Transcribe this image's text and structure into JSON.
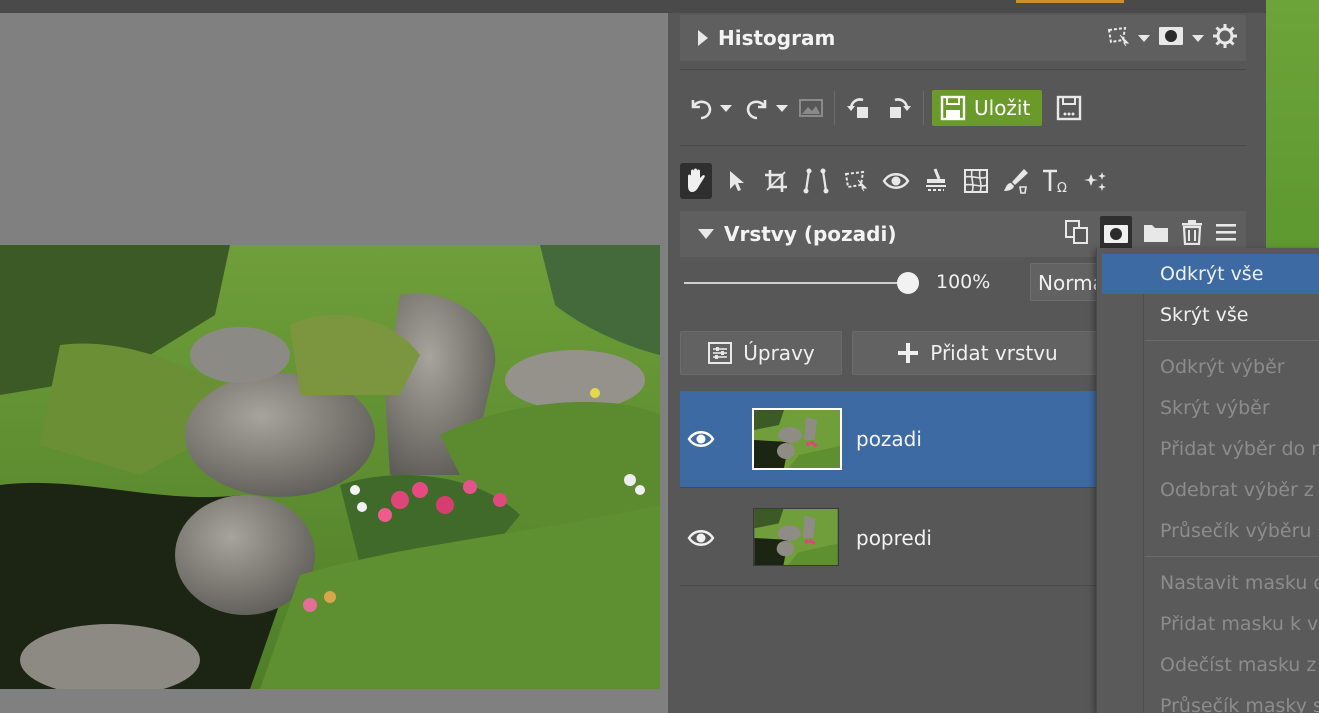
{
  "panel": {
    "histogram": {
      "title": "Histogram"
    },
    "toolbar": {
      "save_label": "Uložit"
    },
    "layers": {
      "title": "Vrstvy (pozadi)",
      "opacity": "100%",
      "blend_mode": "Normální",
      "edits_button": "Úpravy",
      "add_layer_button": "Přidat vrstvu",
      "items": [
        {
          "name": "pozadi",
          "selected": true
        },
        {
          "name": "popredi",
          "selected": false
        }
      ]
    }
  },
  "mask_menu": {
    "items": [
      {
        "label": "Odkrýt vše",
        "enabled": true,
        "highlighted": true
      },
      {
        "label": "Skrýt vše",
        "enabled": true
      },
      {
        "label": "Odkrýt výběr",
        "enabled": false
      },
      {
        "label": "Skrýt výběr",
        "enabled": false
      },
      {
        "label": "Přidat výběr do masky",
        "enabled": false
      },
      {
        "label": "Odebrat výběr z masky",
        "enabled": false
      },
      {
        "label": "Průsečík výběru s maskou",
        "enabled": false
      },
      {
        "label": "Nastavit masku dle výběru",
        "enabled": false
      },
      {
        "label": "Přidat masku k výběru",
        "enabled": false
      },
      {
        "label": "Odečíst masku z výběru",
        "enabled": false
      },
      {
        "label": "Průsečík masky s výběrem",
        "enabled": false
      }
    ]
  },
  "colors": {
    "accent_green": "#6a9a2a",
    "selection_blue": "#3d6aa3",
    "panel_bg": "#575757"
  }
}
